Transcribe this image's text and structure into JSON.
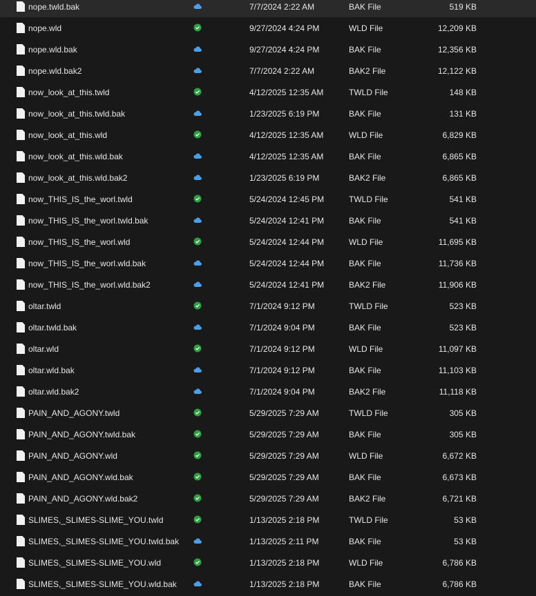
{
  "colors": {
    "background": "#191919",
    "cloud": "#4a9fe8",
    "check": "#2ea043"
  },
  "files": [
    {
      "name": "nope.twld.bak",
      "status": "cloud-icon",
      "date": "7/7/2024 2:22 AM",
      "type": "BAK File",
      "size": "519 KB"
    },
    {
      "name": "nope.wld",
      "status": "check-icon",
      "date": "9/27/2024 4:24 PM",
      "type": "WLD File",
      "size": "12,209 KB"
    },
    {
      "name": "nope.wld.bak",
      "status": "cloud-icon",
      "date": "9/27/2024 4:24 PM",
      "type": "BAK File",
      "size": "12,356 KB"
    },
    {
      "name": "nope.wld.bak2",
      "status": "cloud-icon",
      "date": "7/7/2024 2:22 AM",
      "type": "BAK2 File",
      "size": "12,122 KB"
    },
    {
      "name": "now_look_at_this.twld",
      "status": "check-icon",
      "date": "4/12/2025 12:35 AM",
      "type": "TWLD File",
      "size": "148 KB"
    },
    {
      "name": "now_look_at_this.twld.bak",
      "status": "cloud-icon",
      "date": "1/23/2025 6:19 PM",
      "type": "BAK File",
      "size": "131 KB"
    },
    {
      "name": "now_look_at_this.wld",
      "status": "check-icon",
      "date": "4/12/2025 12:35 AM",
      "type": "WLD File",
      "size": "6,829 KB"
    },
    {
      "name": "now_look_at_this.wld.bak",
      "status": "cloud-icon",
      "date": "4/12/2025 12:35 AM",
      "type": "BAK File",
      "size": "6,865 KB"
    },
    {
      "name": "now_look_at_this.wld.bak2",
      "status": "cloud-icon",
      "date": "1/23/2025 6:19 PM",
      "type": "BAK2 File",
      "size": "6,865 KB"
    },
    {
      "name": "now_THIS_IS_the_worl.twld",
      "status": "check-icon",
      "date": "5/24/2024 12:45 PM",
      "type": "TWLD File",
      "size": "541 KB"
    },
    {
      "name": "now_THIS_IS_the_worl.twld.bak",
      "status": "cloud-icon",
      "date": "5/24/2024 12:41 PM",
      "type": "BAK File",
      "size": "541 KB"
    },
    {
      "name": "now_THIS_IS_the_worl.wld",
      "status": "check-icon",
      "date": "5/24/2024 12:44 PM",
      "type": "WLD File",
      "size": "11,695 KB"
    },
    {
      "name": "now_THIS_IS_the_worl.wld.bak",
      "status": "cloud-icon",
      "date": "5/24/2024 12:44 PM",
      "type": "BAK File",
      "size": "11,736 KB"
    },
    {
      "name": "now_THIS_IS_the_worl.wld.bak2",
      "status": "cloud-icon",
      "date": "5/24/2024 12:41 PM",
      "type": "BAK2 File",
      "size": "11,906 KB"
    },
    {
      "name": "oltar.twld",
      "status": "check-icon",
      "date": "7/1/2024 9:12 PM",
      "type": "TWLD File",
      "size": "523 KB"
    },
    {
      "name": "oltar.twld.bak",
      "status": "cloud-icon",
      "date": "7/1/2024 9:04 PM",
      "type": "BAK File",
      "size": "523 KB"
    },
    {
      "name": "oltar.wld",
      "status": "check-icon",
      "date": "7/1/2024 9:12 PM",
      "type": "WLD File",
      "size": "11,097 KB"
    },
    {
      "name": "oltar.wld.bak",
      "status": "cloud-icon",
      "date": "7/1/2024 9:12 PM",
      "type": "BAK File",
      "size": "11,103 KB"
    },
    {
      "name": "oltar.wld.bak2",
      "status": "cloud-icon",
      "date": "7/1/2024 9:04 PM",
      "type": "BAK2 File",
      "size": "11,118 KB"
    },
    {
      "name": "PAIN_AND_AGONY.twld",
      "status": "check-icon",
      "date": "5/29/2025 7:29 AM",
      "type": "TWLD File",
      "size": "305 KB"
    },
    {
      "name": "PAIN_AND_AGONY.twld.bak",
      "status": "check-icon",
      "date": "5/29/2025 7:29 AM",
      "type": "BAK File",
      "size": "305 KB"
    },
    {
      "name": "PAIN_AND_AGONY.wld",
      "status": "check-icon",
      "date": "5/29/2025 7:29 AM",
      "type": "WLD File",
      "size": "6,672 KB"
    },
    {
      "name": "PAIN_AND_AGONY.wld.bak",
      "status": "check-icon",
      "date": "5/29/2025 7:29 AM",
      "type": "BAK File",
      "size": "6,673 KB"
    },
    {
      "name": "PAIN_AND_AGONY.wld.bak2",
      "status": "check-icon",
      "date": "5/29/2025 7:29 AM",
      "type": "BAK2 File",
      "size": "6,721 KB"
    },
    {
      "name": "SLIMES,_SLIMES-SLIME_YOU.twld",
      "status": "check-icon",
      "date": "1/13/2025 2:18 PM",
      "type": "TWLD File",
      "size": "53 KB"
    },
    {
      "name": "SLIMES,_SLIMES-SLIME_YOU.twld.bak",
      "status": "cloud-icon",
      "date": "1/13/2025 2:11 PM",
      "type": "BAK File",
      "size": "53 KB"
    },
    {
      "name": "SLIMES,_SLIMES-SLIME_YOU.wld",
      "status": "check-icon",
      "date": "1/13/2025 2:18 PM",
      "type": "WLD File",
      "size": "6,786 KB"
    },
    {
      "name": "SLIMES,_SLIMES-SLIME_YOU.wld.bak",
      "status": "cloud-icon",
      "date": "1/13/2025 2:18 PM",
      "type": "BAK File",
      "size": "6,786 KB"
    }
  ]
}
